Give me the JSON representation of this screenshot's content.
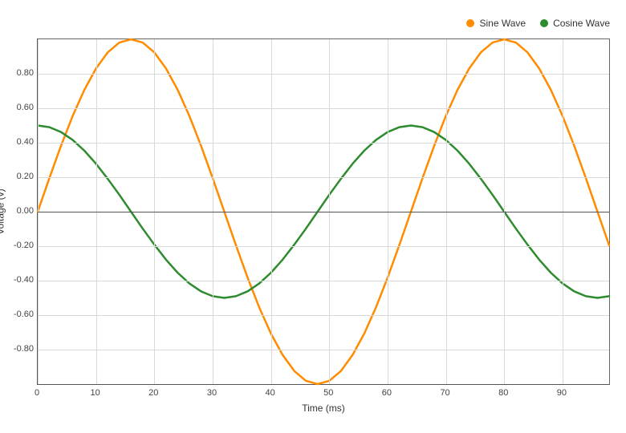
{
  "chart_data": {
    "type": "line",
    "xlabel": "Time (ms)",
    "ylabel": "Voltage (v)",
    "xlim": [
      0,
      98
    ],
    "ylim": [
      -1.0,
      1.0
    ],
    "x_ticks": [
      0,
      10,
      20,
      30,
      40,
      50,
      60,
      70,
      80,
      90
    ],
    "y_ticks": [
      -0.8,
      -0.6,
      -0.4,
      -0.2,
      0.0,
      0.2,
      0.4,
      0.6,
      0.8
    ],
    "x": [
      0,
      2,
      4,
      6,
      8,
      10,
      12,
      14,
      16,
      18,
      20,
      22,
      24,
      26,
      28,
      30,
      32,
      34,
      36,
      38,
      40,
      42,
      44,
      46,
      48,
      50,
      52,
      54,
      56,
      58,
      60,
      62,
      64,
      66,
      68,
      70,
      72,
      74,
      76,
      78,
      80,
      82,
      84,
      86,
      88,
      90,
      92,
      94,
      96,
      98
    ],
    "series": [
      {
        "name": "Sine Wave",
        "color": "#ff8c00",
        "values": [
          0.0,
          0.195,
          0.383,
          0.556,
          0.707,
          0.831,
          0.924,
          0.981,
          1.0,
          0.981,
          0.924,
          0.831,
          0.707,
          0.556,
          0.383,
          0.195,
          0.0,
          -0.195,
          -0.383,
          -0.556,
          -0.707,
          -0.831,
          -0.924,
          -0.981,
          -1.0,
          -0.981,
          -0.924,
          -0.831,
          -0.707,
          -0.556,
          -0.383,
          -0.195,
          0.0,
          0.195,
          0.383,
          0.556,
          0.707,
          0.831,
          0.924,
          0.981,
          1.0,
          0.981,
          0.924,
          0.831,
          0.707,
          0.556,
          0.383,
          0.195,
          0.0,
          -0.195
        ]
      },
      {
        "name": "Cosine Wave",
        "color": "#2e8b2e",
        "values": [
          0.5,
          0.49,
          0.462,
          0.416,
          0.354,
          0.278,
          0.191,
          0.098,
          0.0,
          -0.098,
          -0.191,
          -0.278,
          -0.354,
          -0.416,
          -0.462,
          -0.49,
          -0.5,
          -0.49,
          -0.462,
          -0.416,
          -0.354,
          -0.278,
          -0.191,
          -0.098,
          0.0,
          0.098,
          0.191,
          0.278,
          0.354,
          0.416,
          0.462,
          0.49,
          0.5,
          0.49,
          0.462,
          0.416,
          0.354,
          0.278,
          0.191,
          0.098,
          0.0,
          -0.098,
          -0.191,
          -0.278,
          -0.354,
          -0.416,
          -0.462,
          -0.49,
          -0.5,
          -0.49
        ]
      }
    ],
    "legend_position": "top-right",
    "grid": true
  }
}
